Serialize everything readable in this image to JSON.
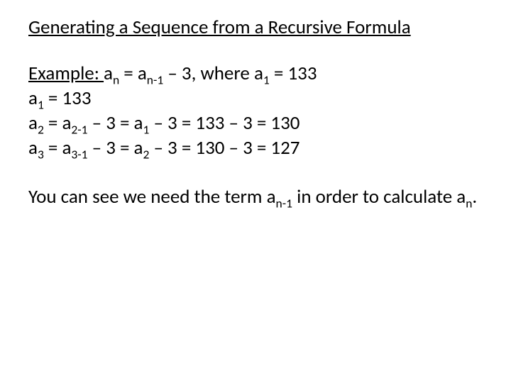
{
  "title": "Generating a Sequence from a Recursive Formula",
  "example": {
    "label": "Example: ",
    "formula_lhs": "a",
    "formula_sub1": "n",
    "formula_eq": " = a",
    "formula_sub2": "n-1",
    "formula_rhs": " – 3, where a",
    "formula_sub3": "1",
    "formula_tail": " = 133"
  },
  "lines": {
    "l1_a": "a",
    "l1_sub": "1",
    "l1_b": " = 133",
    "l2_a": "a",
    "l2_s1": "2",
    "l2_b": " = a",
    "l2_s2": "2-1",
    "l2_c": " – 3 = a",
    "l2_s3": "1",
    "l2_d": " – 3 = 133 – 3 = 130",
    "l3_a": "a",
    "l3_s1": "3",
    "l3_b": " = a",
    "l3_s2": "3-1",
    "l3_c": " – 3 = a",
    "l3_s3": "2",
    "l3_d": " – 3 = 130 – 3 = 127"
  },
  "conclusion": {
    "p1": "You can see we need the term a",
    "sub1": "n-1",
    "p2": " in order to calculate a",
    "sub2": "n",
    "p3": "."
  }
}
